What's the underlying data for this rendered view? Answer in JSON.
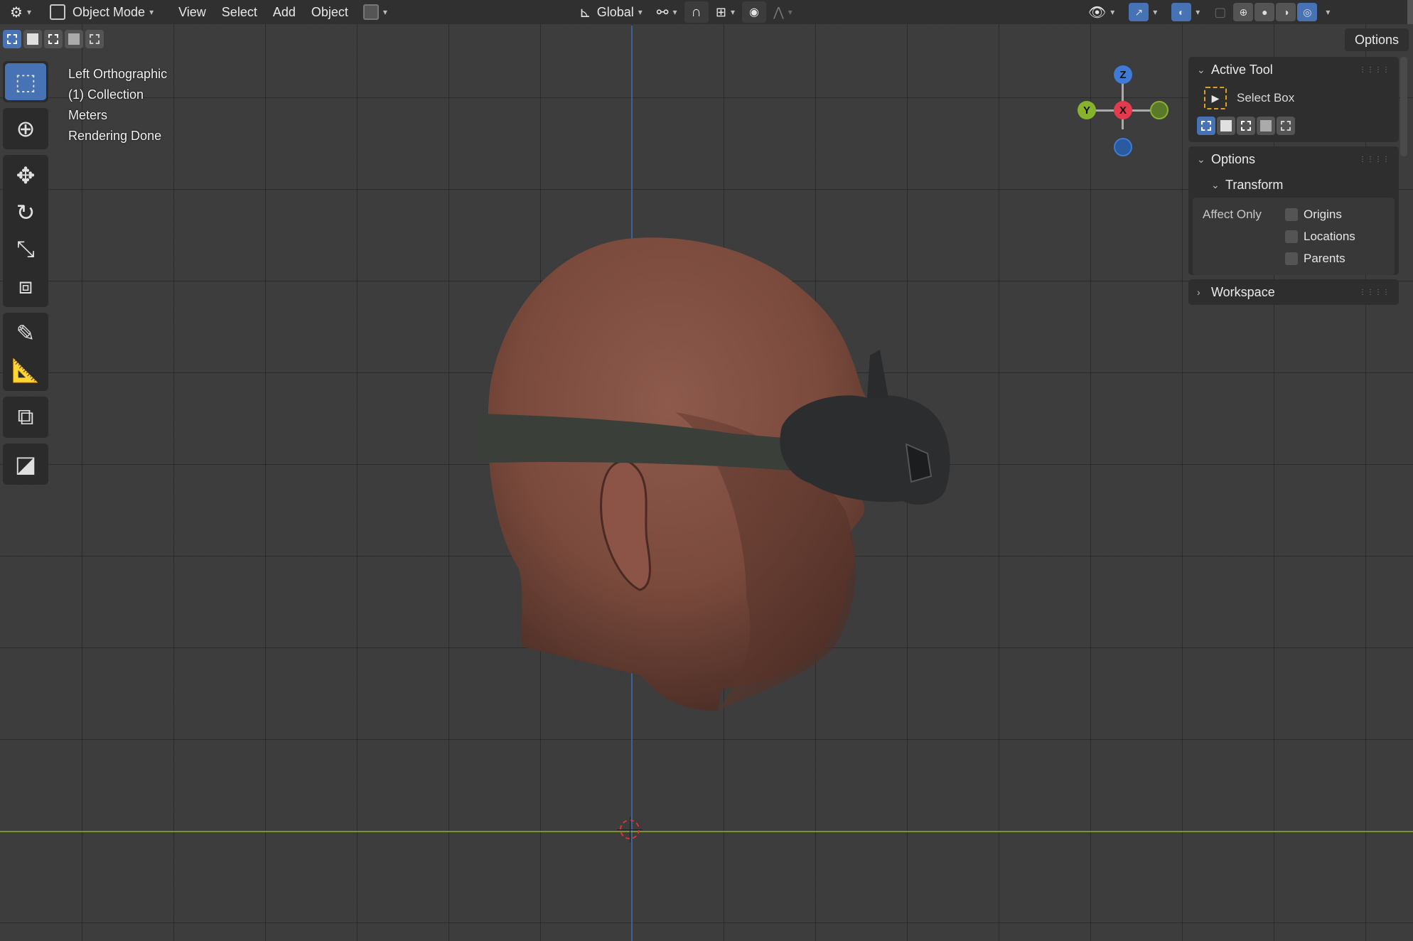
{
  "header": {
    "mode_label": "Object Mode",
    "menus": [
      "View",
      "Select",
      "Add",
      "Object"
    ],
    "transform_orientation": "Global",
    "options_label": "Options"
  },
  "viewport": {
    "overlay": [
      "Left Orthographic",
      "(1) Collection",
      "Meters",
      "Rendering Done"
    ],
    "gizmo": {
      "z": "Z",
      "y": "Y",
      "x": "X"
    }
  },
  "toolbar": {
    "tools": [
      "select-box-icon",
      "cursor-icon",
      "move-icon",
      "rotate-icon",
      "scale-icon",
      "transform-icon",
      "annotate-icon",
      "measure-icon",
      "add-cube-icon",
      "pad-icon"
    ]
  },
  "npanel": {
    "active_tool_title": "Active Tool",
    "active_tool_name": "Select Box",
    "options_title": "Options",
    "transform_title": "Transform",
    "affect_only_label": "Affect Only",
    "checkboxes": [
      "Origins",
      "Locations",
      "Parents"
    ],
    "workspace_title": "Workspace"
  },
  "colors": {
    "accent": "#4772b3",
    "axis_x": "#e33a4d",
    "axis_y": "#86b32b",
    "axis_z": "#3f7ad6"
  }
}
